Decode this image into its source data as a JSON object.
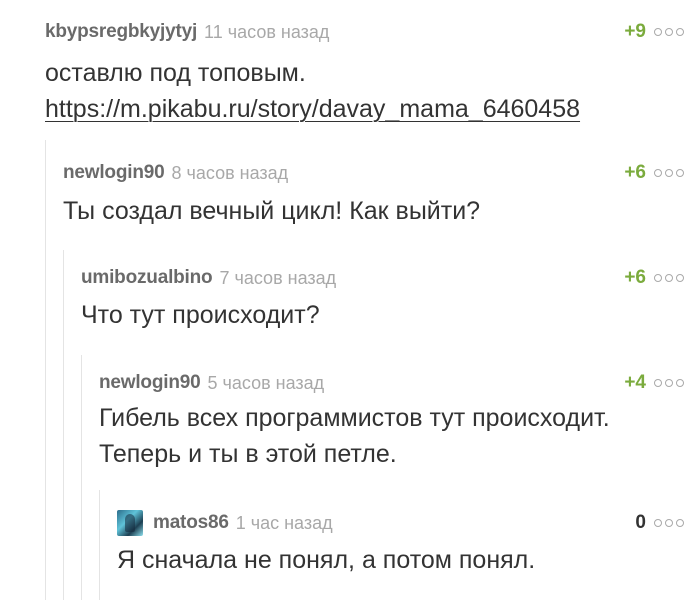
{
  "comments": [
    {
      "author": "kbypsregbkyjytyj",
      "time": "11 часов назад",
      "rating": "+9",
      "text": "оставлю под топовым.",
      "link": "https://m.pikabu.ru/story/davay_mama_6460458",
      "more_icon": "more-dots-icon"
    },
    {
      "author": "newlogin90",
      "time": "8 часов назад",
      "rating": "+6",
      "text": "Ты создал вечный цикл! Как выйти?",
      "more_icon": "more-dots-icon"
    },
    {
      "author": "umibozualbino",
      "time": "7 часов назад",
      "rating": "+6",
      "text": "Что тут происходит?",
      "more_icon": "more-dots-icon"
    },
    {
      "author": "newlogin90",
      "time": "5 часов назад",
      "rating": "+4",
      "text_line1": "Гибель всех программистов тут происходит.",
      "text_line2": "Теперь и ты в этой петле.",
      "more_icon": "more-dots-icon"
    },
    {
      "author": "matos86",
      "time": "1 час назад",
      "rating": "0",
      "text": "Я сначала не понял, а потом понял.",
      "avatar": "user-avatar-icon",
      "more_icon": "more-dots-icon"
    }
  ],
  "colors": {
    "positive_rating": "#7bab3d",
    "author": "#6a6a6a",
    "time": "#a8a8a8",
    "text": "#333333",
    "indent_line": "#e4e4e4"
  }
}
